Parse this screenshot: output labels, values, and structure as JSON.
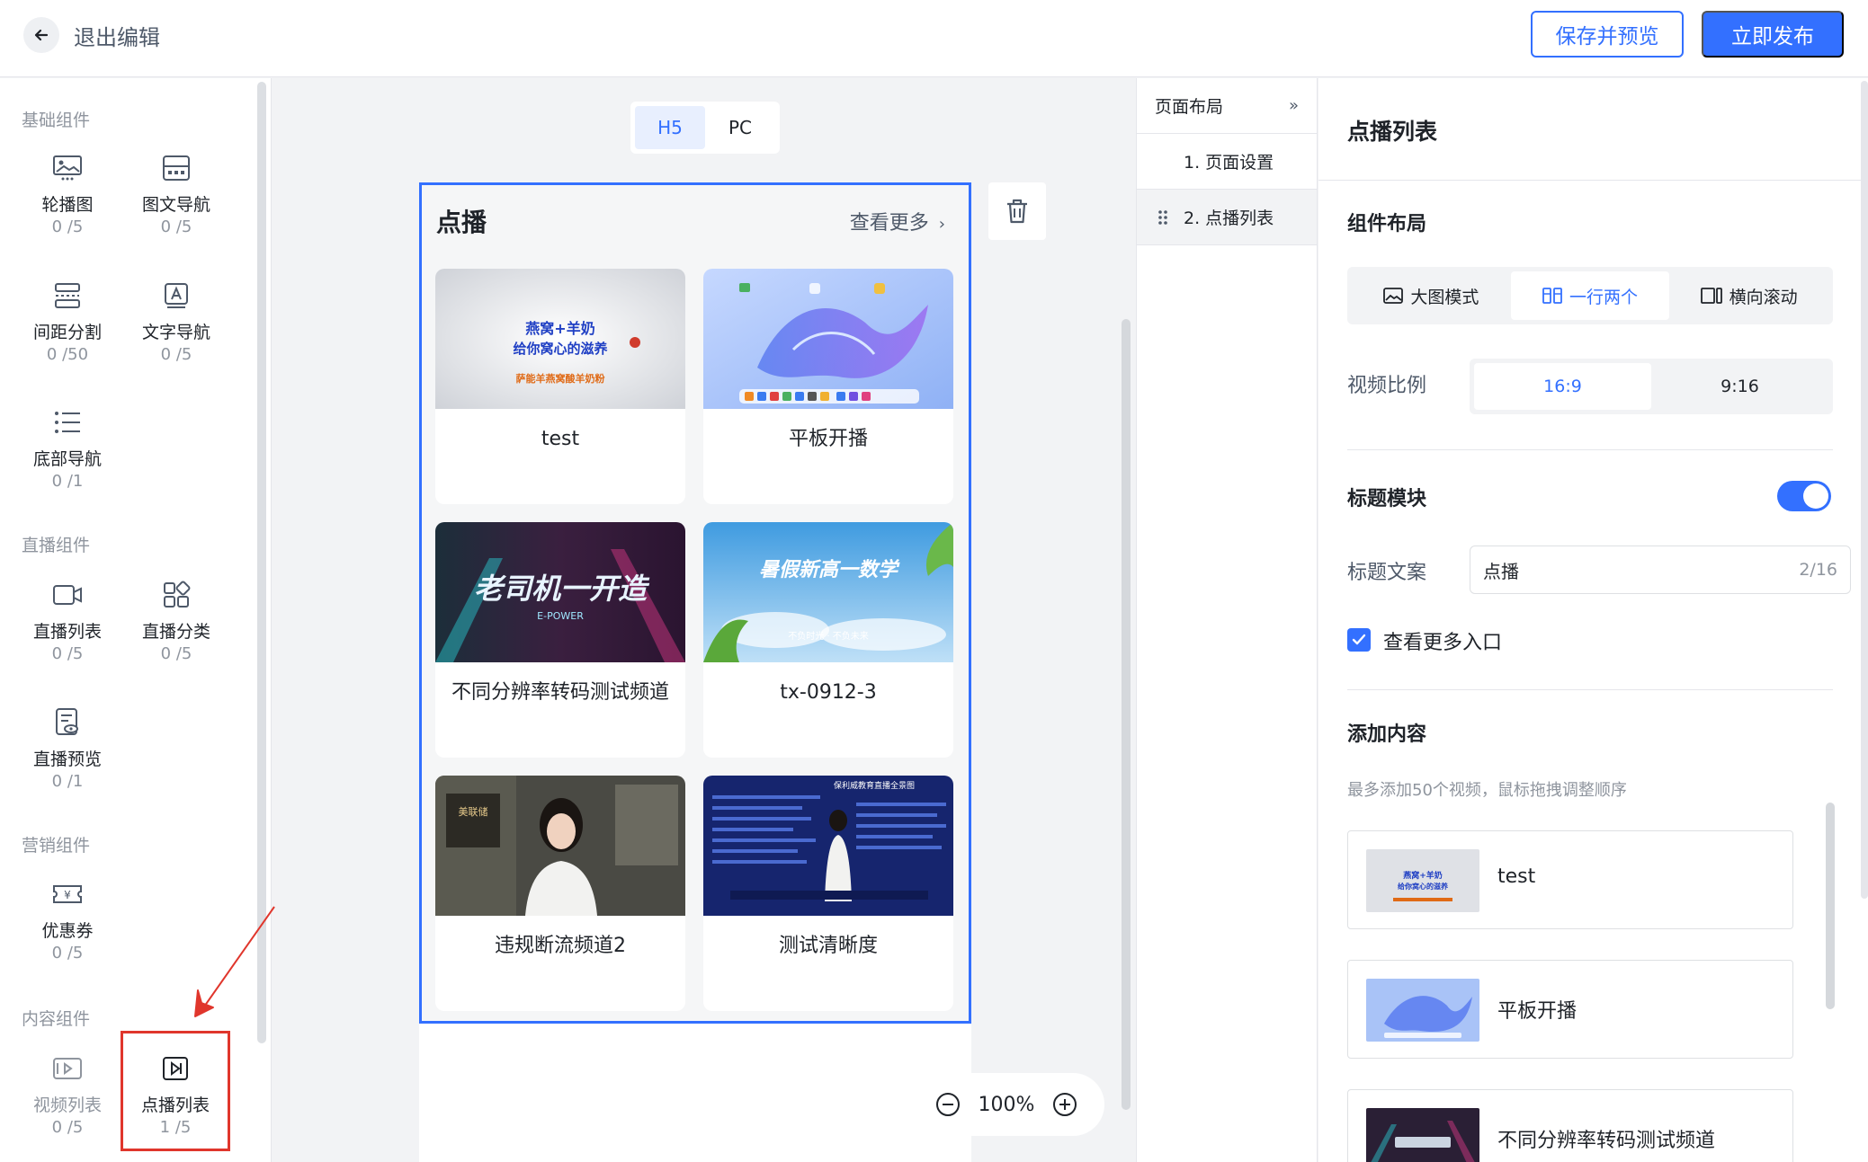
{
  "header": {
    "exit_label": "退出编辑",
    "save_preview": "保存并预览",
    "publish": "立即发布"
  },
  "sidebar": {
    "groups": {
      "basic": "基础组件",
      "live": "直播组件",
      "marketing": "营销组件",
      "content": "内容组件"
    },
    "components": [
      {
        "name": "轮播图",
        "count": "0 /5",
        "icon": "carousel-icon"
      },
      {
        "name": "图文导航",
        "count": "0 /5",
        "icon": "image-nav-icon"
      },
      {
        "name": "间距分割",
        "count": "0 /50",
        "icon": "spacing-icon"
      },
      {
        "name": "文字导航",
        "count": "0 /5",
        "icon": "text-nav-icon"
      },
      {
        "name": "底部导航",
        "count": "0 /1",
        "icon": "bottom-nav-icon"
      },
      {
        "name": "直播列表",
        "count": "0 /5",
        "icon": "live-list-icon"
      },
      {
        "name": "直播分类",
        "count": "0 /5",
        "icon": "live-category-icon"
      },
      {
        "name": "直播预览",
        "count": "0 /1",
        "icon": "live-preview-icon"
      },
      {
        "name": "优惠券",
        "count": "0 /5",
        "icon": "coupon-icon"
      },
      {
        "name": "视频列表",
        "count": "0 /5",
        "icon": "video-list-icon"
      },
      {
        "name": "点播列表",
        "count": "1 /5",
        "icon": "vod-list-icon"
      }
    ]
  },
  "canvas": {
    "device_tabs": [
      "H5",
      "PC"
    ],
    "active_device": "H5",
    "block_title": "点播",
    "more_label": "查看更多",
    "cards": [
      {
        "title": "test"
      },
      {
        "title": "平板开播"
      },
      {
        "title": "不同分辨率转码测试频道"
      },
      {
        "title": "tx-0912-3"
      },
      {
        "title": "违规断流频道2"
      },
      {
        "title": "测试清晰度"
      }
    ],
    "thumb_text": {
      "t1_line1": "燕窝+羊奶",
      "t1_line2": "给你窝心的滋养",
      "t1_line3": "萨能羊燕窝酸羊奶粉",
      "t3_main": "老司机一开造",
      "t3_sub": "E-POWER",
      "t4_main": "暑假新高一数学",
      "t4_sub": "不负时光 · 不负未来",
      "t5_brand": "美联储",
      "t6_head": "保利威教育直播全景图"
    },
    "zoom": "100%"
  },
  "outline": {
    "title": "页面布局",
    "items": [
      "1. 页面设置",
      "2. 点播列表"
    ]
  },
  "props": {
    "title": "点播列表",
    "layout_section": "组件布局",
    "layout_options": [
      "大图模式",
      "一行两个",
      "横向滚动"
    ],
    "active_layout": "一行两个",
    "ratio_label": "视频比例",
    "ratio_options": [
      "16:9",
      "9:16"
    ],
    "active_ratio": "16:9",
    "title_module": "标题模块",
    "title_module_on": true,
    "title_text_label": "标题文案",
    "title_text_value": "点播",
    "title_text_count": "2/16",
    "more_entry_label": "查看更多入口",
    "add_content": "添加内容",
    "add_hint": "最多添加50个视频，鼠标拖拽调整顺序",
    "content_items": [
      "test",
      "平板开播",
      "不同分辨率转码测试频道"
    ]
  },
  "colors": {
    "accent": "#3370ff",
    "annotation": "#e0362c"
  }
}
